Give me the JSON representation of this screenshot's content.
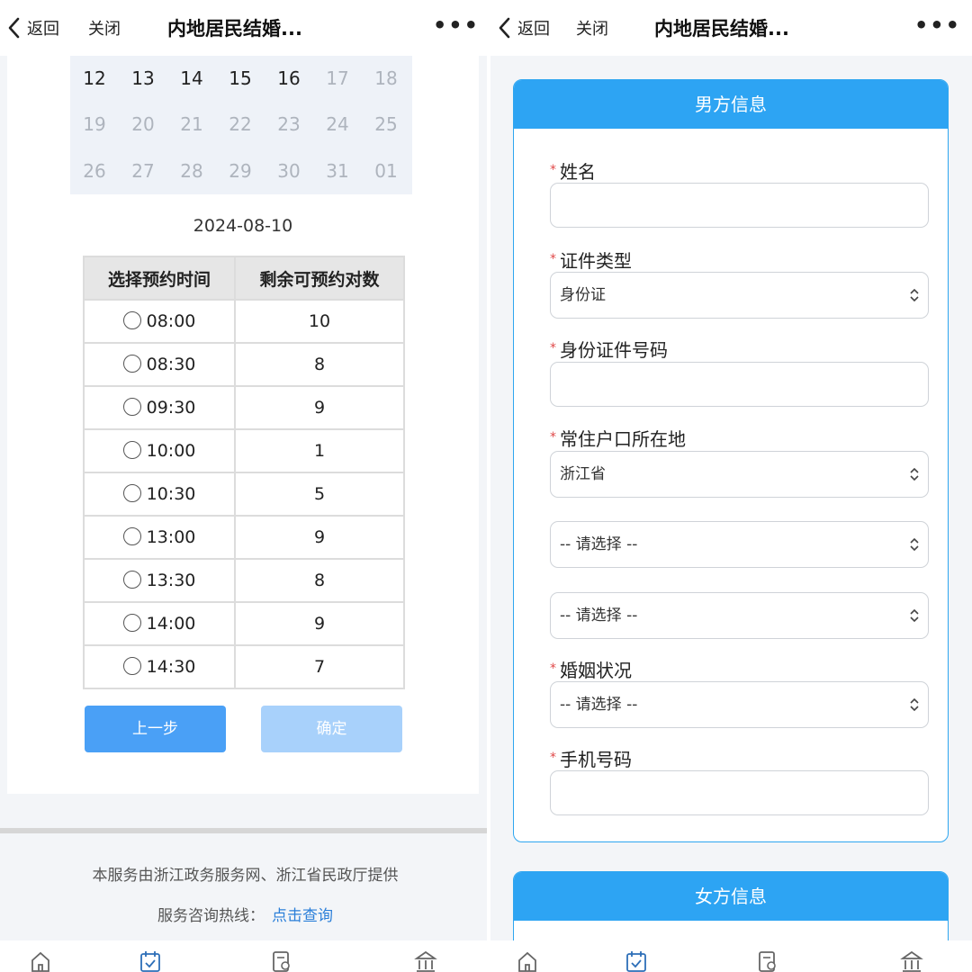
{
  "nav": {
    "back_label": "返回",
    "close_label": "关闭",
    "title": "内地居民结婚...",
    "more_label": "•••"
  },
  "calendar": {
    "rows": [
      [
        {
          "d": "12",
          "active": true
        },
        {
          "d": "13",
          "active": true
        },
        {
          "d": "14",
          "active": true
        },
        {
          "d": "15",
          "active": true
        },
        {
          "d": "16",
          "active": true
        },
        {
          "d": "17",
          "active": false
        },
        {
          "d": "18",
          "active": false
        }
      ],
      [
        {
          "d": "19",
          "active": false
        },
        {
          "d": "20",
          "active": false
        },
        {
          "d": "21",
          "active": false
        },
        {
          "d": "22",
          "active": false
        },
        {
          "d": "23",
          "active": false
        },
        {
          "d": "24",
          "active": false
        },
        {
          "d": "25",
          "active": false
        }
      ],
      [
        {
          "d": "26",
          "active": false
        },
        {
          "d": "27",
          "active": false
        },
        {
          "d": "28",
          "active": false
        },
        {
          "d": "29",
          "active": false
        },
        {
          "d": "30",
          "active": false
        },
        {
          "d": "31",
          "active": false
        },
        {
          "d": "01",
          "active": false
        }
      ]
    ],
    "selected_date": "2024-08-10"
  },
  "slots_table": {
    "headers": [
      "选择预约时间",
      "剩余可预约对数"
    ],
    "rows": [
      {
        "time": "08:00",
        "remaining": "10"
      },
      {
        "time": "08:30",
        "remaining": "8"
      },
      {
        "time": "09:30",
        "remaining": "9"
      },
      {
        "time": "10:00",
        "remaining": "1"
      },
      {
        "time": "10:30",
        "remaining": "5"
      },
      {
        "time": "13:00",
        "remaining": "9"
      },
      {
        "time": "13:30",
        "remaining": "8"
      },
      {
        "time": "14:00",
        "remaining": "9"
      },
      {
        "time": "14:30",
        "remaining": "7"
      }
    ]
  },
  "buttons": {
    "prev_label": "上一步",
    "confirm_label": "确定"
  },
  "footer": {
    "provider_text": "本服务由浙江政务服务网、浙江省民政厅提供",
    "hotline_label": "服务咨询热线：",
    "hotline_link": "点击查询"
  },
  "form": {
    "male_section_title": "男方信息",
    "female_section_title": "女方信息",
    "required_mark": "*",
    "name_label": "姓名",
    "id_type_label": "证件类型",
    "id_type_value": "身份证",
    "id_number_label": "身份证件号码",
    "residence_label": "常住户口所在地",
    "province_value": "浙江省",
    "city_value": "-- 请选择 --",
    "district_value": "-- 请选择 --",
    "marital_label": "婚姻状况",
    "marital_value": "-- 请选择 --",
    "phone_label": "手机号码"
  },
  "tabbar_icons": [
    "home-icon",
    "calendar-check-icon",
    "search-document-icon",
    "government-building-icon"
  ],
  "colors": {
    "primary": "#2da4f3",
    "button_active": "#4aa0f6",
    "button_disabled": "#a8d1fb",
    "link": "#2b7fd9",
    "required": "#e04848"
  }
}
